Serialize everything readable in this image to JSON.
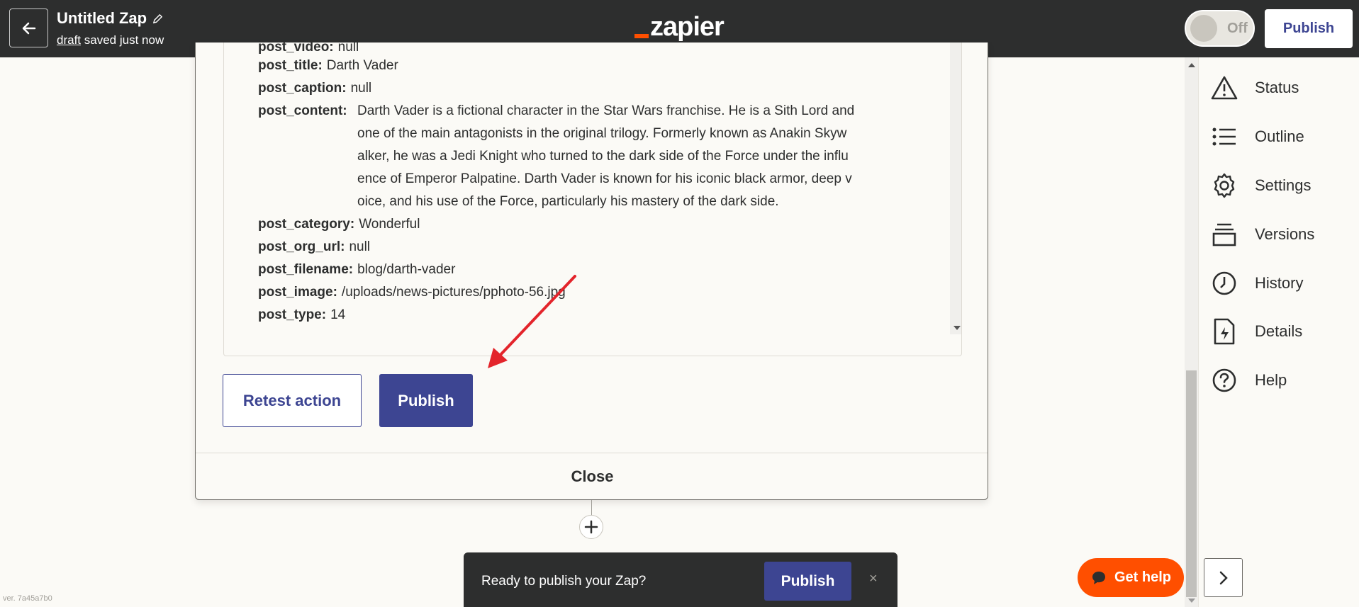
{
  "header": {
    "zap_title": "Untitled Zap",
    "draft_link": "draft",
    "saved_text": "saved just now",
    "logo_text": "zapier",
    "toggle_label": "Off",
    "publish_label": "Publish"
  },
  "record": {
    "fields": [
      {
        "key": "post_video:",
        "value": "null"
      },
      {
        "key": "post_title:",
        "value": "Darth Vader"
      },
      {
        "key": "post_caption:",
        "value": "null"
      },
      {
        "key": "post_content:",
        "value": ""
      },
      {
        "key": "post_category:",
        "value": "Wonderful"
      },
      {
        "key": "post_org_url:",
        "value": "null"
      },
      {
        "key": "post_filename:",
        "value": "blog/darth-vader"
      },
      {
        "key": "post_image:",
        "value": "/uploads/news-pictures/pphoto-56.jpg"
      },
      {
        "key": "post_type:",
        "value": "14"
      }
    ],
    "content_lines": [
      "Darth Vader is a fictional character in the Star Wars franchise. He is a Sith Lord and",
      "one of the main antagonists in the original trilogy. Formerly known as Anakin Skyw",
      "alker, he was a Jedi Knight who turned to the dark side of the Force under the influ",
      "ence of Emperor Palpatine. Darth Vader is known for his iconic black armor, deep v",
      "oice, and his use of the Force, particularly his mastery of the dark side."
    ]
  },
  "modal": {
    "retest_label": "Retest action",
    "publish_label": "Publish",
    "close_label": "Close"
  },
  "banner": {
    "text": "Ready to publish your Zap?",
    "publish_label": "Publish",
    "close_symbol": "×"
  },
  "sidebar": {
    "items": [
      {
        "label": "Status",
        "icon": "warning-icon"
      },
      {
        "label": "Outline",
        "icon": "list-icon"
      },
      {
        "label": "Settings",
        "icon": "gear-icon"
      },
      {
        "label": "Versions",
        "icon": "versions-icon"
      },
      {
        "label": "History",
        "icon": "clock-icon"
      },
      {
        "label": "Details",
        "icon": "file-bolt-icon"
      },
      {
        "label": "Help",
        "icon": "help-icon"
      }
    ]
  },
  "help_button": {
    "label": "Get help"
  },
  "version_text": "ver. 7a45a7b0",
  "colors": {
    "header_bg": "#2d2e2e",
    "brand_orange": "#ff4f00",
    "primary_button": "#3d4592",
    "annotation_arrow": "#e3242b"
  }
}
